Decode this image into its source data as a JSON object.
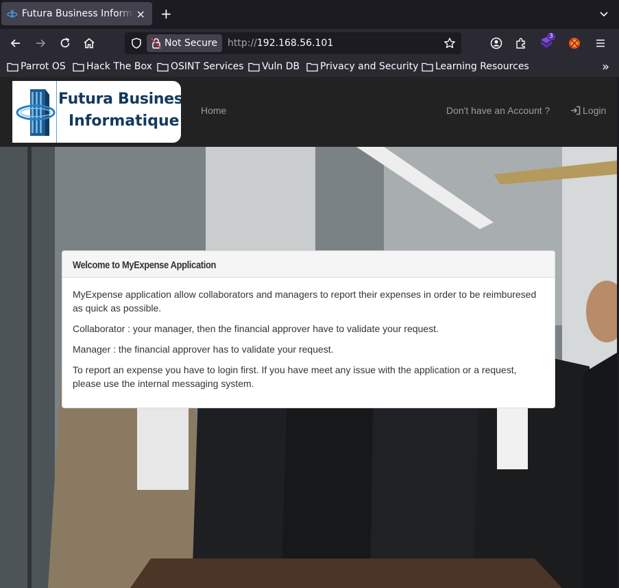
{
  "browser": {
    "tab": {
      "title": "Futura Business Informatique",
      "close": "×"
    },
    "new_tab": "+",
    "security_label": "Not Secure",
    "url": {
      "protocol": "http://",
      "host": "192.168.56.101"
    },
    "extension_badge": "3",
    "bookmarks": [
      {
        "label": "Parrot OS"
      },
      {
        "label": "Hack The Box"
      },
      {
        "label": "OSINT Services"
      },
      {
        "label": "Vuln DB"
      },
      {
        "label": "Privacy and Security"
      },
      {
        "label": "Learning Resources"
      }
    ],
    "bookmarks_more": "»"
  },
  "site": {
    "logo": {
      "line1": "Futura Business",
      "line2": "Informatique"
    },
    "nav": {
      "home": "Home",
      "signup": "Don't have an Account ?",
      "login": "Login"
    },
    "panel": {
      "title": "Welcome to MyExpense Application",
      "paragraphs": [
        "MyExpense application allow collaborators and managers to report their expenses in order to be reimburesed as quick as possible.",
        "Collaborator : your manager, then the financial approver have to validate your request.",
        "Manager : the financial approver has to validate your request.",
        "To report an expense you have to login first. If you have meet any issue with the application or a request, please use the internal messaging system."
      ]
    }
  },
  "colors": {
    "browser_bg": "#1c1b22",
    "toolbar_bg": "#2b2a33",
    "site_nav_bg": "#222222",
    "logo_blue": "#123a5e",
    "nav_link": "#9d9d9d"
  }
}
